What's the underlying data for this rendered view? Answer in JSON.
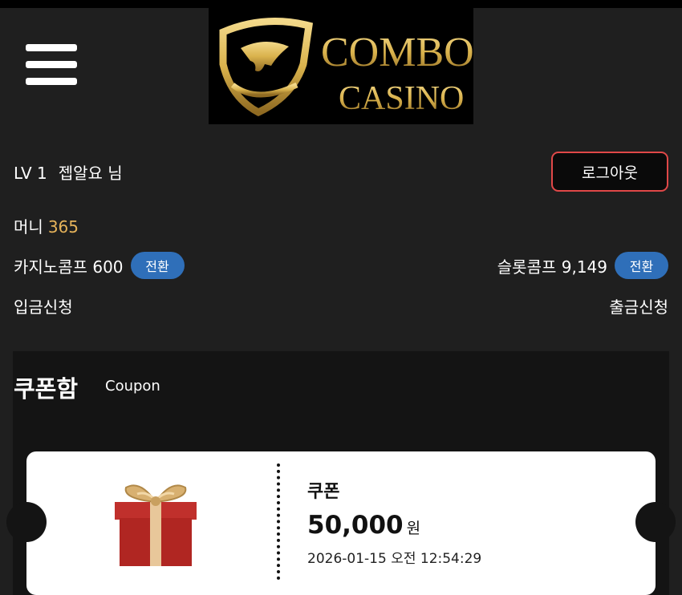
{
  "header": {
    "logo": {
      "line1": "COMBO",
      "line2": "CASINO"
    },
    "menu_icon": "hamburger-icon"
  },
  "user": {
    "level": "LV 1",
    "name": "젭알요 님",
    "logout_label": "로그아웃"
  },
  "money": {
    "label": "머니",
    "value": "365"
  },
  "comps": {
    "casino": {
      "label": "카지노콤프 600",
      "button": "전환"
    },
    "slot": {
      "label": "슬롯콤프 9,149",
      "button": "전환"
    }
  },
  "actions": {
    "deposit": "입금신청",
    "withdraw": "출금신청"
  },
  "coupon_box": {
    "title": "쿠폰함",
    "subtitle": "Coupon",
    "ticket": {
      "label": "쿠폰",
      "amount": "50,000",
      "unit": "원",
      "date": "2026-01-15 오전 12:54:29",
      "icon": "gift-box-icon"
    }
  },
  "colors": {
    "background": "#1f1f1f",
    "money_accent": "#e6b35a",
    "pill_blue": "#2f6fb9",
    "logout_border": "#e04848",
    "logo_gold": "#d9b24c"
  }
}
